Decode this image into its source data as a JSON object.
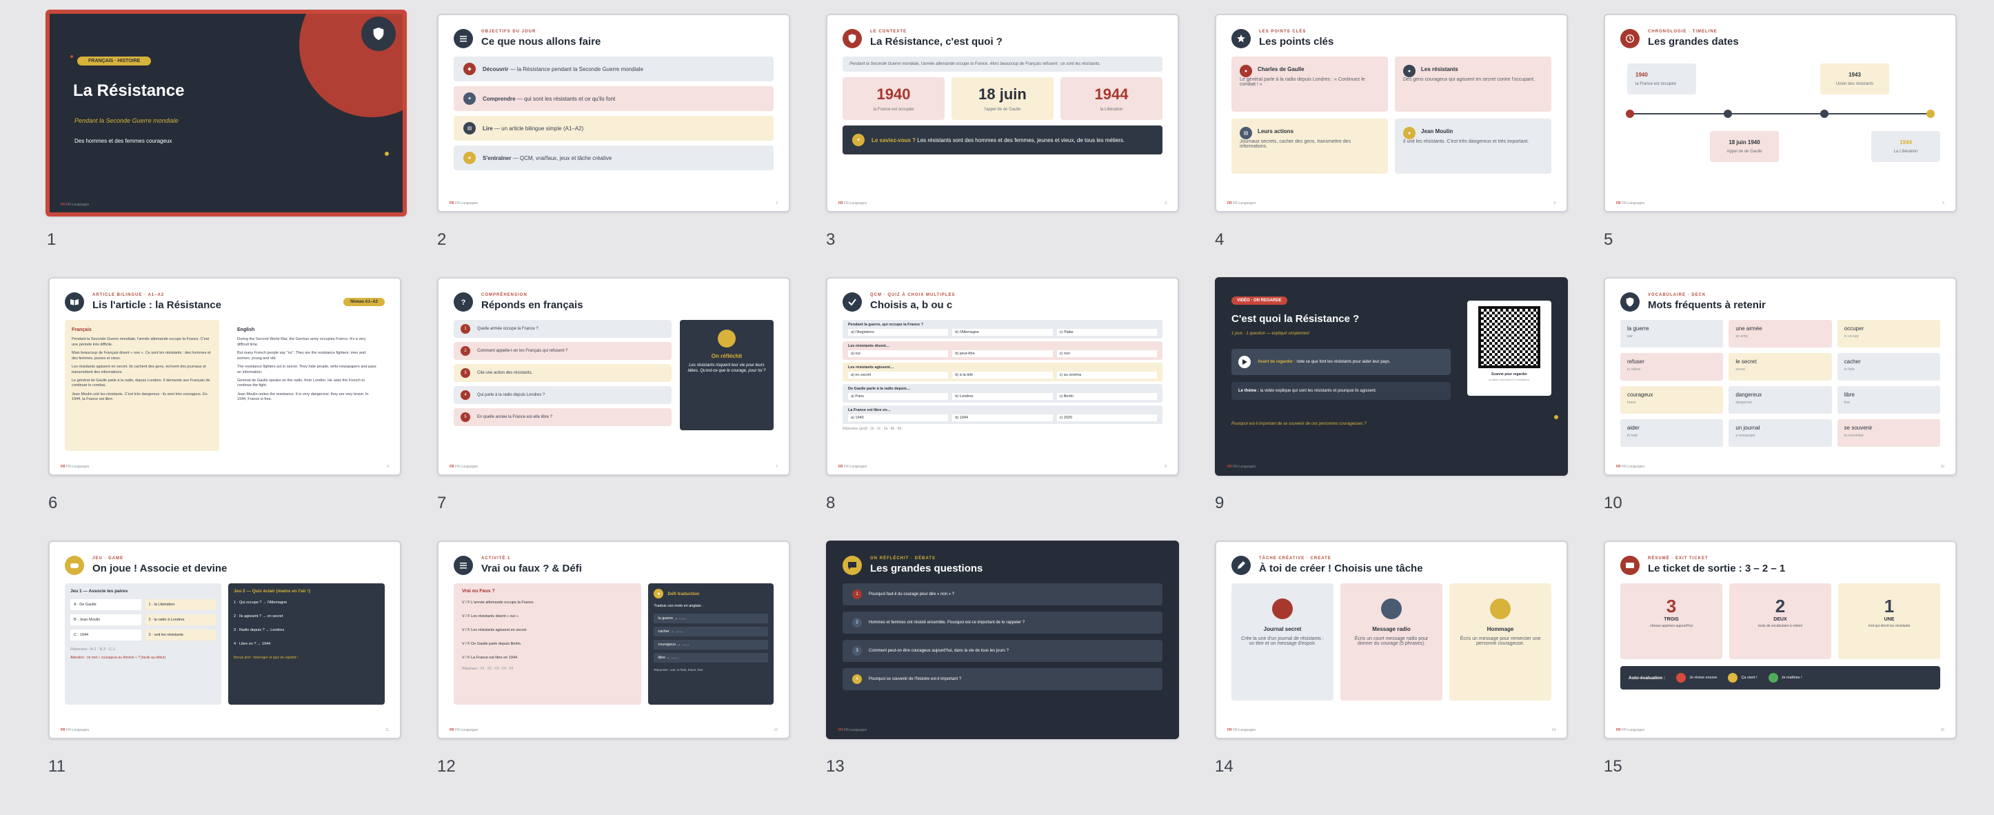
{
  "brand": "FR-Languages",
  "colors": {
    "accent": "#c8473b",
    "navy": "#262d38",
    "gold": "#d8b23a"
  },
  "slides": [
    {
      "num": "1",
      "badge": "FRANÇAIS · HISTOIRE",
      "title": "La Résistance",
      "subtitle": "Pendant la Seconde Guerre mondiale",
      "tagline": "Des hommes et des femmes courageux"
    },
    {
      "num": "2",
      "kicker": "OBJECTIFS DU JOUR",
      "title": "Ce que nous allons faire",
      "rows": [
        {
          "b": "Découvrir",
          "t": " — la Résistance pendant la Seconde Guerre mondiale"
        },
        {
          "b": "Comprendre",
          "t": " — qui sont les résistants et ce qu'ils font"
        },
        {
          "b": "Lire",
          "t": " — un article bilingue simple (A1–A2)"
        },
        {
          "b": "S'entraîner",
          "t": " — QCM, vrai/faux, jeux et tâche créative"
        }
      ]
    },
    {
      "num": "3",
      "kicker": "LE CONTEXTE",
      "title": "La Résistance, c'est quoi ?",
      "intro": "Pendant la Seconde Guerre mondiale, l'armée allemande occupe la France. Alors beaucoup de Français refusent : ce sont les résistants.",
      "dates": [
        {
          "n": "1940",
          "t": "la France est occupée"
        },
        {
          "n": "18 juin",
          "t": "l'appel de de Gaulle"
        },
        {
          "n": "1944",
          "t": "la Libération"
        }
      ],
      "callout_b": "Le saviez-vous ?",
      "callout": " Les résistants sont des hommes et des femmes, jeunes et vieux, de tous les métiers."
    },
    {
      "num": "4",
      "kicker": "LES POINTS CLÉS",
      "title": "Les points clés",
      "cards": [
        {
          "t": "Charles de Gaulle",
          "d": "Le général parle à la radio depuis Londres : « Continuez le combat ! »"
        },
        {
          "t": "Les résistants",
          "d": "Des gens courageux qui agissent en secret contre l'occupant."
        },
        {
          "t": "Leurs actions",
          "d": "Journaux secrets, cacher des gens, transmettre des informations."
        },
        {
          "t": "Jean Moulin",
          "d": "Il unit les résistants. C'est très dangereux et très important."
        }
      ]
    },
    {
      "num": "5",
      "kicker": "CHRONOLOGIE · TIMELINE",
      "title": "Les grandes dates",
      "events": [
        {
          "n": "1940",
          "t": "la France est occupée"
        },
        {
          "n": "1943",
          "t": "Union des résistants"
        },
        {
          "n": "18 juin 1940",
          "t": "Appel de de Gaulle"
        },
        {
          "n": "1944",
          "t": "La Libération"
        }
      ]
    },
    {
      "num": "6",
      "kicker": "ARTICLE BILINGUE · A1–A2",
      "title": "Lis l'article : la Résistance",
      "badge": "Niveau A1–A2",
      "fr_h": "Français",
      "en_h": "English",
      "fr": [
        "Pendant la Seconde Guerre mondiale, l'armée allemande occupe la France. C'est une période très difficile.",
        "Mais beaucoup de Français disent « non ». Ce sont les résistants : des hommes et des femmes, jeunes et vieux.",
        "Les résistants agissent en secret. Ils cachent des gens, écrivent des journaux et transmettent des informations.",
        "Le général de Gaulle parle à la radio, depuis Londres. Il demande aux Français de continuer le combat.",
        "Jean Moulin unit les résistants. C'est très dangereux : ils sont très courageux. En 1944, la France est libre."
      ],
      "en": [
        "During the Second World War, the German army occupies France. It's a very difficult time.",
        "But many French people say \"no\". They are the resistance fighters: men and women, young and old.",
        "The resistance fighters act in secret. They hide people, write newspapers and pass on information.",
        "General de Gaulle speaks on the radio, from London. He asks the French to continue the fight.",
        "Jean Moulin unites the resistance. It is very dangerous: they are very brave. In 1944, France is free."
      ]
    },
    {
      "num": "7",
      "kicker": "COMPRÉHENSION",
      "title": "Réponds en français",
      "qs": [
        "Quelle armée occupe la France ?",
        "Comment appelle-t-on les Français qui refusent ?",
        "Cite une action des résistants.",
        "Qui parle à la radio depuis Londres ?",
        "En quelle année la France est-elle libre ?"
      ],
      "side_t": "On réfléchit",
      "side_d": "Les résistants risquent leur vie pour leurs idées. Qu'est-ce que le courage, pour toi ?"
    },
    {
      "num": "8",
      "kicker": "QCM · QUIZ À CHOIX MULTIPLES",
      "title": "Choisis a, b ou c",
      "qs": [
        {
          "q": "Pendant la guerre, qui occupe la France ?",
          "o": [
            "a) l'Angleterre",
            "b) l'Allemagne",
            "c) l'Italie"
          ]
        },
        {
          "q": "Les résistants disent…",
          "o": [
            "a) oui",
            "b) peut-être",
            "c) non"
          ]
        },
        {
          "q": "Les résistants agissent…",
          "o": [
            "a) en secret",
            "b) à la télé",
            "c) au cinéma"
          ]
        },
        {
          "q": "De Gaulle parle à la radio depuis…",
          "o": [
            "a) Paris",
            "b) Londres",
            "c) Berlin"
          ]
        },
        {
          "q": "La France est libre en…",
          "o": [
            "a) 1940",
            "b) 1944",
            "c) 2020"
          ]
        }
      ],
      "answers": "Réponses (prof) : 1b · 2c · 3a · 4b · 5b"
    },
    {
      "num": "9",
      "badge": "VIDÉO · ON REGARDE",
      "title": "C'est quoi la Résistance ?",
      "sub": "1 jeux · 1 question — expliqué simplement",
      "play_b": "Avant de regarder :",
      "play": " note ce que font les résistants pour aider leur pays.",
      "after_b": "Le thème :",
      "after": " la vidéo explique qui sont les résistants et pourquoi ils agissent.",
      "qr_t": "Scanne pour regarder",
      "qr_s": "youtube.com/watch?v=resistance",
      "question": "Pourquoi est-il important de se souvenir de ces personnes courageuses ?"
    },
    {
      "num": "10",
      "kicker": "VOCABULAIRE · DECK",
      "title": "Mots fréquents à retenir",
      "words": [
        {
          "w": "la guerre",
          "t": "war"
        },
        {
          "w": "une armée",
          "t": "an army"
        },
        {
          "w": "occuper",
          "t": "to occupy"
        },
        {
          "w": "refuser",
          "t": "to refuse"
        },
        {
          "w": "le secret",
          "t": "secret"
        },
        {
          "w": "cacher",
          "t": "to hide"
        },
        {
          "w": "courageux",
          "t": "brave"
        },
        {
          "w": "dangereux",
          "t": "dangerous"
        },
        {
          "w": "libre",
          "t": "free"
        },
        {
          "w": "aider",
          "t": "to help"
        },
        {
          "w": "un journal",
          "t": "a newspaper"
        },
        {
          "w": "se souvenir",
          "t": "to remember"
        }
      ]
    },
    {
      "num": "11",
      "kicker": "JEU · GAME",
      "title": "On joue ! Associe et devine",
      "g1": "Jeu 1 — Associe les paires",
      "left": [
        "A · De Gaulle",
        "B · Jean Moulin",
        "C · 1944"
      ],
      "right": [
        "1 · la Libération",
        "2 · la radio à Londres",
        "3 · unit les résistants"
      ],
      "g1_ans": "Réponses : A-2 · B-3 · C-1",
      "g2": "Jeu 2 — Quiz éclair (mains en l'air !)",
      "quick": [
        "1 · Qui occupe ? → l'Allemagne",
        "2 · Ils agissent ? → en secret",
        "3 · Radio depuis ? → Londres",
        "4 · Libre en ? → 1944"
      ],
      "g2_note": "Bonus prof : interroger et quiz de rapidité !",
      "note": "Attention : on met « courageux au féminin » ? (facile au début)"
    },
    {
      "num": "12",
      "kicker": "ACTIVITÉ 1",
      "title": "Vrai ou faux ? & Défi",
      "vf_t": "Vrai ou Faux ?",
      "vf": [
        "V / F  L'armée allemande occupe la France.",
        "V / F  Les résistants disent « oui ».",
        "V / F  Les résistants agissent en secret.",
        "V / F  De Gaulle parle depuis Berlin.",
        "V / F  La France est libre en 1944."
      ],
      "vf_ans": "Réponses : V1 · F2 · V3 · F4 · V5",
      "d_t": "Défi traduction",
      "d_s": "Traduis ces mots en anglais :",
      "d_w": [
        "la guerre → ……",
        "cacher → ……",
        "courageux → ……",
        "libre → ……"
      ],
      "d_ans": "Réponses : war, to hide, brave, free"
    },
    {
      "num": "13",
      "kicker": "ON RÉFLÉCHIT · DÉBATS",
      "title": "Les grandes questions",
      "qs": [
        "Pourquoi faut-il du courage pour dire « non » ?",
        "Hommes et femmes ont résisté ensemble. Pourquoi est-ce important de le rappeler ?",
        "Comment peut-on être courageux aujourd'hui, dans la vie de tous les jours ?",
        "Pourquoi se souvenir de l'histoire est-il important ?"
      ]
    },
    {
      "num": "14",
      "kicker": "TÂCHE CRÉATIVE · CREATE",
      "title": "À toi de créer ! Choisis une tâche",
      "tasks": [
        {
          "t": "Journal secret",
          "d": "Crée la une d'un journal de résistants : un titre et un message d'espoir."
        },
        {
          "t": "Message radio",
          "d": "Écris un court message radio pour donner du courage (5 phrases)."
        },
        {
          "t": "Hommage",
          "d": "Écris un message pour remercier une personne courageuse."
        }
      ]
    },
    {
      "num": "15",
      "kicker": "RÉSUMÉ · EXIT TICKET",
      "title": "Le ticket de sortie : 3 – 2 – 1",
      "cols": [
        {
          "n": "3",
          "l": "TROIS",
          "d": "choses apprises aujourd'hui"
        },
        {
          "n": "2",
          "l": "DEUX",
          "d": "mots de vocabulaire à retenir"
        },
        {
          "n": "1",
          "l": "UNE",
          "d": "mot qui décrit les résistants"
        }
      ],
      "auto_t": "Auto-évaluation :",
      "auto": [
        "Je révise encore",
        "Ça vient !",
        "Je maîtrise !"
      ]
    }
  ]
}
